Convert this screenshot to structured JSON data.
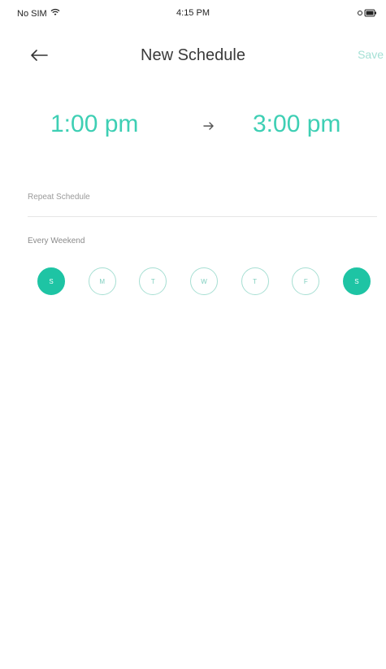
{
  "status_bar": {
    "carrier": "No SIM",
    "time": "4:15 PM",
    "icons": [
      "wifi-icon",
      "battery-icon"
    ]
  },
  "nav": {
    "back_icon": "back-arrow-icon",
    "title": "New Schedule",
    "save_label": "Save"
  },
  "schedule": {
    "start_time": "1:00 pm",
    "end_time": "3:00 pm",
    "arrow_icon": "right-arrow-icon"
  },
  "repeat": {
    "label": "Repeat Schedule",
    "value": "Every Weekend"
  },
  "days": [
    {
      "label": "S",
      "selected": true
    },
    {
      "label": "M",
      "selected": false
    },
    {
      "label": "T",
      "selected": false
    },
    {
      "label": "W",
      "selected": false
    },
    {
      "label": "T",
      "selected": false
    },
    {
      "label": "F",
      "selected": false
    },
    {
      "label": "S",
      "selected": true
    }
  ],
  "colors": {
    "accent": "#1ec4a4",
    "time_text": "#3ecfb4",
    "save_disabled": "#a5e0d5"
  }
}
